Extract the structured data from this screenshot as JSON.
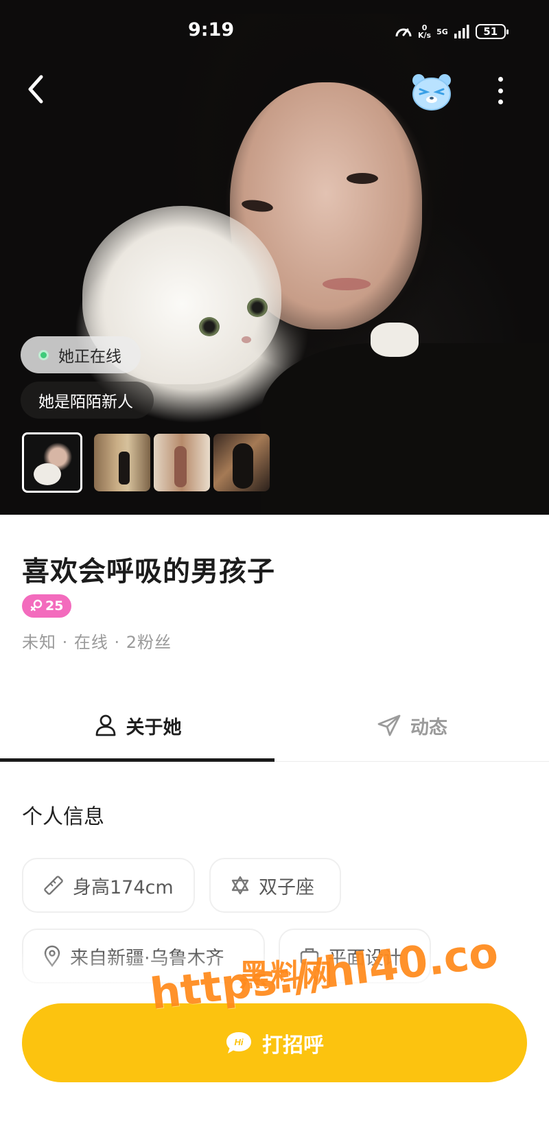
{
  "status_bar": {
    "time": "9:19",
    "net_speed_value": "0",
    "net_speed_unit": "K/s",
    "network": "5G",
    "battery": "51"
  },
  "hero": {
    "online_label": "她正在线",
    "newcomer_label": "她是陌陌新人",
    "photo_count": 4
  },
  "profile": {
    "nickname": "喜欢会呼吸的男孩子",
    "gender_age": "25",
    "meta": "未知 · 在线 · 2粉丝"
  },
  "tabs": [
    {
      "label": "关于她",
      "icon": "person-icon",
      "active": true
    },
    {
      "label": "动态",
      "icon": "send-icon",
      "active": false
    }
  ],
  "personal_info": {
    "title": "个人信息",
    "chips": [
      {
        "label": "身高174cm",
        "icon": "ruler-icon"
      },
      {
        "label": "双子座",
        "icon": "star-of-david-icon"
      },
      {
        "label": "来自新疆·乌鲁木齐",
        "icon": "location-pin-icon"
      },
      {
        "label": "平面设计",
        "icon": "briefcase-icon"
      }
    ]
  },
  "action": {
    "greet_label": "打招呼",
    "hi_text": "Hi"
  },
  "watermark": {
    "line1": "黑料网",
    "line2": "https://hl40.co"
  },
  "colors": {
    "accent": "#fcc30f",
    "gender_badge": "#f36bbd",
    "online_dot": "#3ecb7a"
  }
}
